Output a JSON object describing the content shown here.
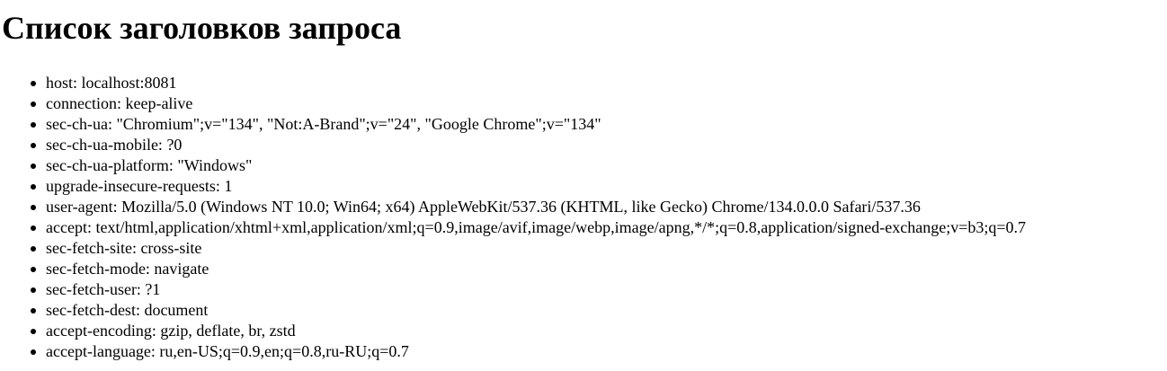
{
  "page": {
    "title": "Список заголовков запроса"
  },
  "headers": [
    "host: localhost:8081",
    "connection: keep-alive",
    "sec-ch-ua: \"Chromium\";v=\"134\", \"Not:A-Brand\";v=\"24\", \"Google Chrome\";v=\"134\"",
    "sec-ch-ua-mobile: ?0",
    "sec-ch-ua-platform: \"Windows\"",
    "upgrade-insecure-requests: 1",
    "user-agent: Mozilla/5.0 (Windows NT 10.0; Win64; x64) AppleWebKit/537.36 (KHTML, like Gecko) Chrome/134.0.0.0 Safari/537.36",
    "accept: text/html,application/xhtml+xml,application/xml;q=0.9,image/avif,image/webp,image/apng,*/*;q=0.8,application/signed-exchange;v=b3;q=0.7",
    "sec-fetch-site: cross-site",
    "sec-fetch-mode: navigate",
    "sec-fetch-user: ?1",
    "sec-fetch-dest: document",
    "accept-encoding: gzip, deflate, br, zstd",
    "accept-language: ru,en-US;q=0.9,en;q=0.8,ru-RU;q=0.7"
  ]
}
